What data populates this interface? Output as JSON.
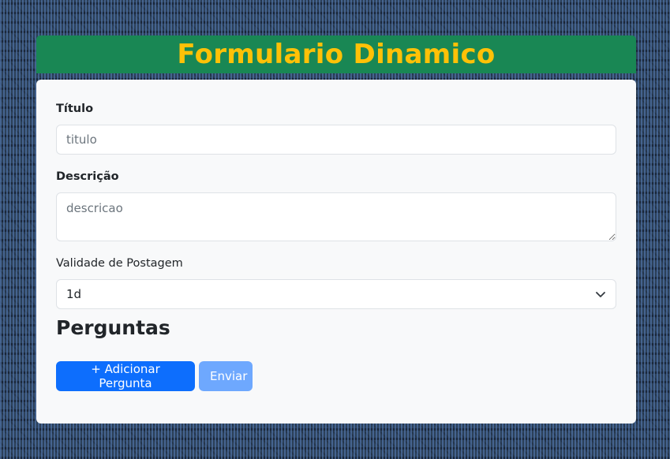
{
  "header": {
    "title": "Formulario Dinamico"
  },
  "form": {
    "titulo_label": "Título",
    "titulo_placeholder": "titulo",
    "descricao_label": "Descrição",
    "descricao_placeholder": "descricao",
    "validade_label": "Validade de Postagem",
    "validade_value": "1d"
  },
  "section": {
    "title": "Perguntas"
  },
  "buttons": {
    "add_label": "+ Adicionar Pergunta",
    "submit_label": "Enviar"
  },
  "colors": {
    "header_bg": "#198754",
    "title_color": "#ffc107",
    "primary": "#0d6efd",
    "primary_disabled": "#6ea8fe",
    "card_bg": "#f8f9fa"
  },
  "icons": {
    "select_arrow": "chevron-down-icon"
  }
}
